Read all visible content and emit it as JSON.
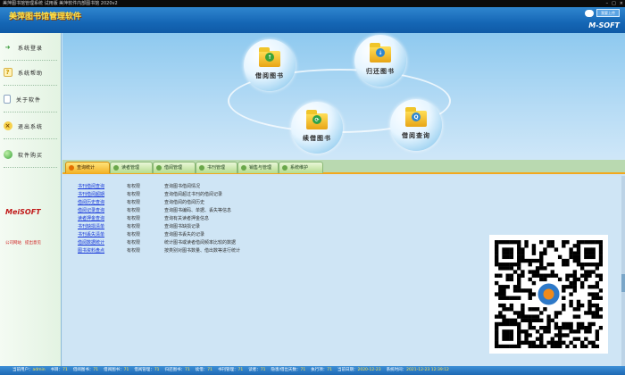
{
  "window": {
    "title": "美萍图书馆管理系统 试用版  美萍软件内部图书馆  2020v2",
    "controls": [
      "–",
      "□",
      "×"
    ]
  },
  "header": {
    "app_title": "美萍图书馆管理软件",
    "mini_button": "我要上传",
    "brand": "M-SOFT"
  },
  "sidebar": {
    "items": [
      {
        "label": "系统登录",
        "icon": "door-icon",
        "color": "#3a9a3a"
      },
      {
        "label": "系统帮助",
        "icon": "question-icon",
        "color": "#e0b010"
      },
      {
        "label": "关于软件",
        "icon": "document-icon",
        "color": "#6a8fb8"
      },
      {
        "label": "退出系统",
        "icon": "exit-icon",
        "color": "#d5a11a"
      },
      {
        "label": "软件购买",
        "icon": "globe-icon",
        "color": "#3aa33a"
      }
    ],
    "brand": "MeiSOFT",
    "links": [
      "公司网站",
      "提出意见"
    ]
  },
  "hero": {
    "buttons": [
      {
        "label": "借阅图书",
        "badge": "↑",
        "badge_color": "#39a339"
      },
      {
        "label": "归还图书",
        "badge": "↓",
        "badge_color": "#2f86cf"
      },
      {
        "label": "续借图书",
        "badge": "⟳",
        "badge_color": "#2ca24a"
      },
      {
        "label": "借阅查询",
        "badge": "Q",
        "badge_color": "#2f86cf"
      }
    ]
  },
  "tabs": [
    "查询统计",
    "读者管理",
    "借阅管理",
    "书刊管理",
    "销售与管理",
    "系统维护"
  ],
  "active_tab": 0,
  "rows": [
    {
      "name": "书刊借阅查询",
      "perm": "有权限",
      "desc": "查询图书借阅情况"
    },
    {
      "name": "书刊借阅超期",
      "perm": "有权限",
      "desc": "查询借阅超过书刊的借阅记录"
    },
    {
      "name": "借阅历史查询",
      "perm": "有权限",
      "desc": "查询借阅的借阅历史"
    },
    {
      "name": "借阅记录查询",
      "perm": "有权限",
      "desc": "查询图书编码、单据、丢失等信息"
    },
    {
      "name": "读者押金查询",
      "perm": "有权限",
      "desc": "查询有关读者押金信息"
    },
    {
      "name": "书刊缺损清单",
      "perm": "有权限",
      "desc": "查询图书缺损记录"
    },
    {
      "name": "书刊丢失清单",
      "perm": "有权限",
      "desc": "查询图书丢失的记录"
    },
    {
      "name": "借阅数据统计",
      "perm": "有权限",
      "desc": "统计图书或读者借阅频率比较的数据"
    },
    {
      "name": "图书资料盘点",
      "perm": "有权限",
      "desc": "按类别对图书数量、借出数等进行统计"
    }
  ],
  "status": [
    {
      "k": "当前用户：",
      "v": "admin"
    },
    {
      "k": "书目：",
      "v": "71"
    },
    {
      "k": "借阅图书：",
      "v": "71"
    },
    {
      "k": "借阅图书：",
      "v": "71"
    },
    {
      "k": "借阅管理：",
      "v": "71"
    },
    {
      "k": "归还图书：",
      "v": "71"
    },
    {
      "k": "续借：",
      "v": "71"
    },
    {
      "k": "书刊管理：",
      "v": "71"
    },
    {
      "k": "读者：",
      "v": "71"
    },
    {
      "k": "隐患/借出天数：",
      "v": "71"
    },
    {
      "k": "执行项：",
      "v": "71"
    },
    {
      "k": "当前日期：",
      "v": "2020-12-23"
    },
    {
      "k": "系统时间：",
      "v": "2021-12-23  12:39:12"
    }
  ]
}
